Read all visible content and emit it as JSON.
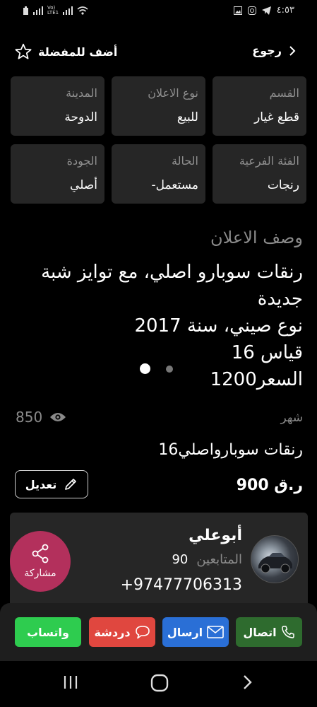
{
  "status_bar": {
    "time": "٤:٥٣"
  },
  "header": {
    "favorite_label": "أضف للمفضلة",
    "back_label": "رجوع"
  },
  "info_cards": [
    {
      "key": "القسم",
      "value": "قطع غيار"
    },
    {
      "key": "نوع الاعلان",
      "value": "للبيع"
    },
    {
      "key": "المدينة",
      "value": "الدوحة"
    },
    {
      "key": "الفئة الفرعية",
      "value": "رنجات"
    },
    {
      "key": "الحالة",
      "value": "مستعمل-"
    },
    {
      "key": "الجودة",
      "value": "أصلي"
    }
  ],
  "description": {
    "title": "وصف الاعلان",
    "lines": [
      "رنقات سوبارو اصلي، مع توايز شبة",
      "جديدة",
      "نوع صيني، سنة 2017",
      "قياس 16",
      "السعر1200"
    ]
  },
  "gallery": {
    "active_index": 0,
    "total": 2
  },
  "views": {
    "count": "850"
  },
  "ad": {
    "period": "شهر",
    "title": "رنقات سوبارواصلي16",
    "price": "900 ر.ق",
    "edit_label": "تعديل"
  },
  "seller": {
    "name": "أبوعلي",
    "followers_label": "المتابعين",
    "followers_count": "90",
    "phone": "+97477706313",
    "share_label": "مشاركة"
  },
  "actions": {
    "call": "اتصال",
    "send": "ارسال",
    "chat": "دردشة",
    "whatsapp": "واتساب"
  },
  "colors": {
    "call": "#2e6b2e",
    "send": "#2a6fd6",
    "chat": "#e0473f",
    "whatsapp": "#2ecc4f",
    "share": "#b3305c",
    "card": "#262626"
  }
}
